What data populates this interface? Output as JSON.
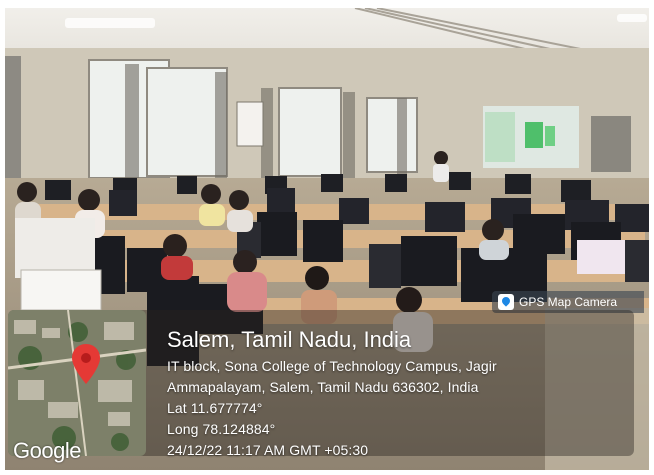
{
  "photo": {
    "description_colors": {
      "ceiling": "#e8e6e0",
      "wall": "#cfc8b8",
      "desk": "#d8b48a",
      "monitor": "#1e1f24",
      "accent_screen": "#8fd0a0"
    }
  },
  "badge": {
    "label": "GPS Map Camera",
    "icon": "map-pin-icon"
  },
  "location": {
    "title": "Salem, Tamil Nadu, India",
    "address_line1": "IT block, Sona College of Technology Campus, Jagir",
    "address_line2": "Ammapalayam, Salem, Tamil Nadu 636302, India",
    "lat": "Lat 11.677774°",
    "long": "Long 78.124884°",
    "datetime": "24/12/22 11:17 AM GMT +05:30"
  },
  "map": {
    "brand": "Google",
    "marker_icon": "map-marker-icon",
    "marker_color": "#e53935"
  }
}
